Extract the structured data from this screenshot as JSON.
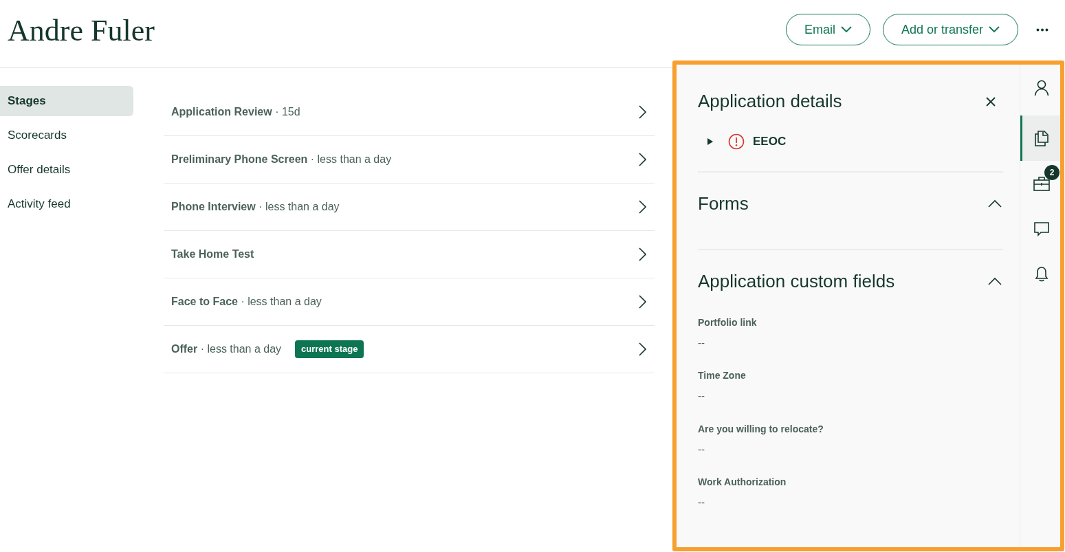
{
  "header": {
    "title": "Andre Fuler",
    "buttons": [
      {
        "label": "Email"
      },
      {
        "label": "Add or transfer"
      }
    ]
  },
  "nav": [
    {
      "label": "Stages",
      "selected": true
    },
    {
      "label": "Scorecards",
      "selected": false
    },
    {
      "label": "Offer details",
      "selected": false
    },
    {
      "label": "Activity feed",
      "selected": false
    }
  ],
  "stages": [
    {
      "name": "Application Review",
      "duration": "· 15d"
    },
    {
      "name": "Preliminary Phone Screen",
      "duration": "· less than a day"
    },
    {
      "name": "Phone Interview",
      "duration": "· less than a day"
    },
    {
      "name": "Take Home Test"
    },
    {
      "name": "Face to Face",
      "duration": "· less than a day"
    },
    {
      "name": "Offer",
      "duration": "· less than a day",
      "badge": "current stage"
    }
  ],
  "panel": {
    "title": "Application details",
    "eeoc": {
      "label": "EEOC",
      "expanded": false
    },
    "sections": [
      {
        "title": "Forms",
        "expanded": true
      },
      {
        "title": "Application custom fields",
        "expanded": true,
        "fields": [
          {
            "label": "Portfolio link",
            "value": "--"
          },
          {
            "label": "Time Zone",
            "value": "--"
          },
          {
            "label": "Are you willing to relocate?",
            "value": "--"
          },
          {
            "label": "Work Authorization",
            "value": "--"
          }
        ]
      }
    ]
  },
  "rail": [
    {
      "kind": "person",
      "selected": false
    },
    {
      "kind": "documents",
      "selected": true
    },
    {
      "kind": "briefcase",
      "selected": false,
      "badge": "2"
    },
    {
      "kind": "comment",
      "selected": false
    },
    {
      "kind": "bell",
      "selected": false
    }
  ]
}
